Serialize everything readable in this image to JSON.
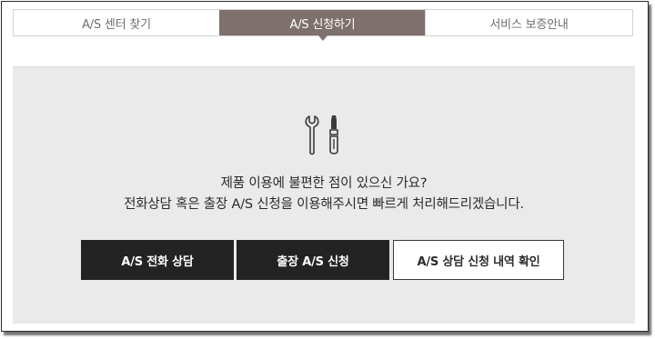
{
  "tabs": [
    {
      "label": "A/S 센터 찾기",
      "active": false
    },
    {
      "label": "A/S 신청하기",
      "active": true
    },
    {
      "label": "서비스 보증안내",
      "active": false
    }
  ],
  "panel": {
    "icon": "wrench-screwdriver-icon",
    "line1": "제품 이용에 불편한 점이 있으신 가요?",
    "line2": "전화상담 혹은 출장 A/S 신청을 이용해주시면 빠르게 처리해드리겠습니다."
  },
  "buttons": {
    "phone": "A/S 전화 상담",
    "visit": "출장 A/S 신청",
    "history": "A/S 상담 신청 내역 확인"
  },
  "colors": {
    "active_tab": "#7d706d",
    "panel_bg": "#eaeaea",
    "dark_button": "#232323"
  }
}
